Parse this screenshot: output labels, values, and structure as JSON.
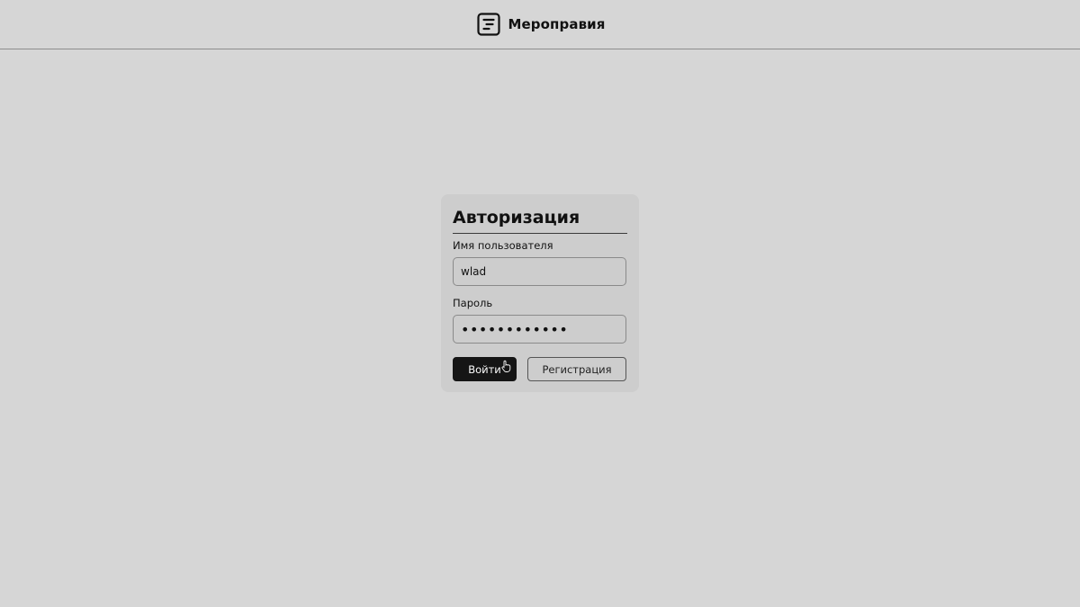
{
  "header": {
    "brand_icon": "list-document-icon",
    "title": "Мероправия"
  },
  "auth": {
    "title": "Авторизация",
    "username_label": "Имя пользователя",
    "username_value": "wlad",
    "password_label": "Пароль",
    "password_value": "••••••••••••",
    "login_button": "Войти",
    "register_button": "Регистрация",
    "cursor_icon": "hand-pointer-icon"
  },
  "colors": {
    "background": "#d6d6d6",
    "card": "#cdcdcd",
    "primary_button": "#151515",
    "text": "#111111"
  }
}
